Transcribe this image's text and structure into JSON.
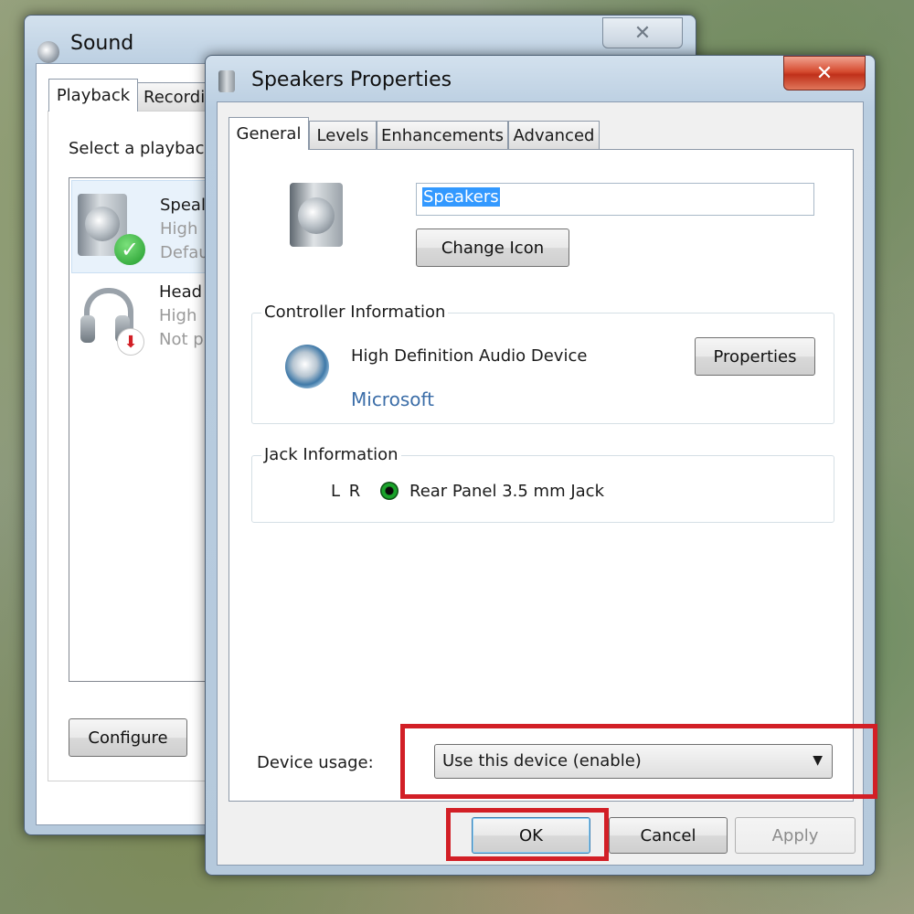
{
  "sound_window": {
    "title": "Sound",
    "tabs": [
      "Playback",
      "Recordi"
    ],
    "instruction": "Select a playback",
    "devices": [
      {
        "name": "Speal",
        "line2": "High",
        "line3": "Defau",
        "icon": "speaker-icon",
        "status": "default-check"
      },
      {
        "name": "Head",
        "line2": "High",
        "line3": "Not p",
        "icon": "headphones-icon",
        "status": "disconnected-arrow"
      }
    ],
    "configure_label": "Configure"
  },
  "props_window": {
    "title": "Speakers Properties",
    "close_glyph": "✕",
    "tabs": [
      "General",
      "Levels",
      "Enhancements",
      "Advanced"
    ],
    "device_name_value": "Speakers",
    "change_icon_label": "Change Icon",
    "controller": {
      "section_label": "Controller Information",
      "device": "High Definition Audio Device",
      "manufacturer": "Microsoft",
      "properties_label": "Properties"
    },
    "jack": {
      "section_label": "Jack Information",
      "channels": "L R",
      "jack_color": "#1aa32a",
      "description": "Rear Panel 3.5 mm Jack"
    },
    "device_usage": {
      "label": "Device usage:",
      "selected": "Use this device (enable)"
    },
    "buttons": {
      "ok": "OK",
      "cancel": "Cancel",
      "apply": "Apply"
    }
  },
  "colors": {
    "highlight": "#d21f26",
    "selection": "#3399ff",
    "link": "#3c6ea8"
  }
}
